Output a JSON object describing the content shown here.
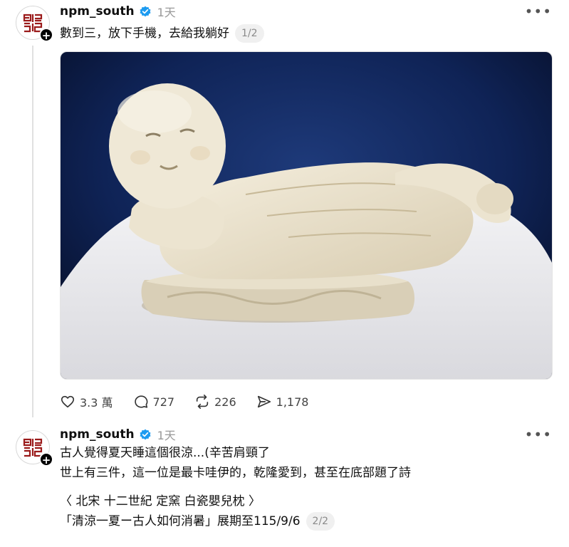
{
  "posts": [
    {
      "username": "npm_south",
      "time": "1天",
      "text": "數到三，放下手機，去給我躺好",
      "pager": "1/2",
      "image_alt": "white porcelain pillow in the shape of a reclining child",
      "actions": {
        "likes": "3.3 萬",
        "comments": "727",
        "reposts": "226",
        "shares": "1,178"
      }
    },
    {
      "username": "npm_south",
      "time": "1天",
      "lines": [
        "古人覺得夏天睡這個很涼...(辛苦肩頸了",
        "世上有三件，這一位是最卡哇伊的，乾隆愛到，甚至在底部題了詩",
        "〈 北宋 十二世紀 定窯 白瓷嬰兒枕 〉",
        "「清涼一夏ー古人如何消暑」展期至115/9/6"
      ],
      "pager": "2/2"
    }
  ],
  "colors": {
    "verified": "#1d9bf0",
    "logo": "#9b1b1b"
  }
}
